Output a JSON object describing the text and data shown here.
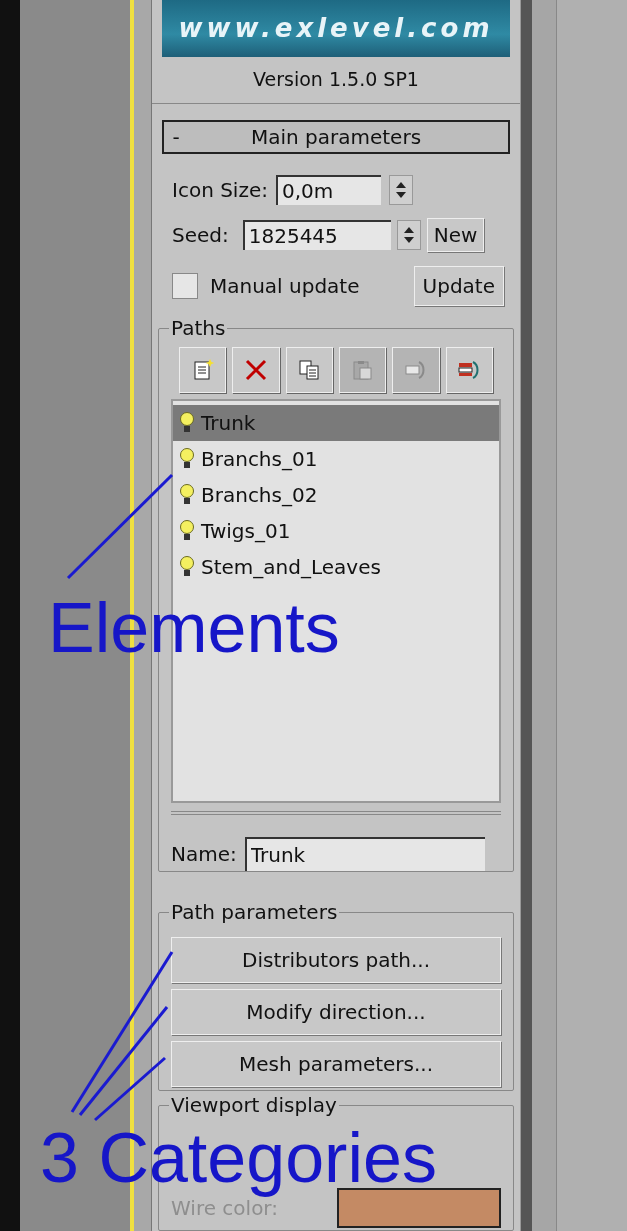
{
  "banner": {
    "text": "www.exlevel.com"
  },
  "version": "Version 1.5.0 SP1",
  "rollout": {
    "toggle": "-",
    "title": "Main parameters",
    "expanded": true
  },
  "icon_size": {
    "label": "Icon Size:",
    "value": "0,0m"
  },
  "seed": {
    "label": "Seed:",
    "value": "1825445",
    "button": "New"
  },
  "manual_update": {
    "label": "Manual update",
    "checked": false,
    "button": "Update"
  },
  "paths": {
    "title": "Paths",
    "toolbar": [
      {
        "kind": "new",
        "disabled": false
      },
      {
        "kind": "delete",
        "disabled": false
      },
      {
        "kind": "copy",
        "disabled": false
      },
      {
        "kind": "paste",
        "disabled": true
      },
      {
        "kind": "import",
        "disabled": true
      },
      {
        "kind": "export",
        "disabled": false
      }
    ],
    "items": [
      {
        "label": "Trunk",
        "selected": true
      },
      {
        "label": "Branchs_01",
        "selected": false
      },
      {
        "label": "Branchs_02",
        "selected": false
      },
      {
        "label": "Twigs_01",
        "selected": false
      },
      {
        "label": "Stem_and_Leaves",
        "selected": false
      }
    ],
    "name": {
      "label": "Name:",
      "value": "Trunk"
    }
  },
  "path_parameters": {
    "title": "Path parameters",
    "buttons": [
      "Distributors path...",
      "Modify direction...",
      "Mesh parameters..."
    ]
  },
  "viewport_display": {
    "title": "Viewport display",
    "wire_color": {
      "label": "Wire color:",
      "disabled": true,
      "color": "#c48a64"
    }
  },
  "annotations": [
    {
      "text": "Elements"
    },
    {
      "text": "3 Categories"
    }
  ]
}
